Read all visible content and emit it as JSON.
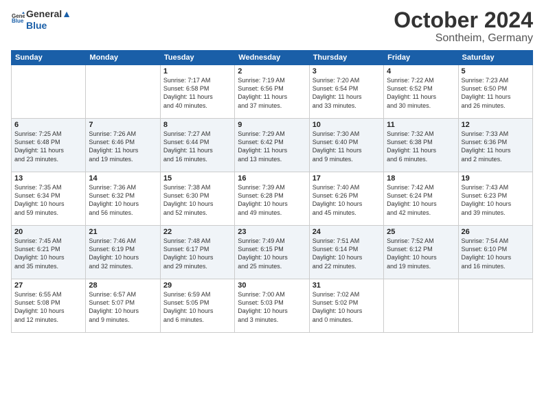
{
  "header": {
    "logo_line1": "General",
    "logo_line2": "Blue",
    "month": "October 2024",
    "location": "Sontheim, Germany"
  },
  "weekdays": [
    "Sunday",
    "Monday",
    "Tuesday",
    "Wednesday",
    "Thursday",
    "Friday",
    "Saturday"
  ],
  "weeks": [
    [
      {
        "day": "",
        "info": ""
      },
      {
        "day": "",
        "info": ""
      },
      {
        "day": "1",
        "info": "Sunrise: 7:17 AM\nSunset: 6:58 PM\nDaylight: 11 hours\nand 40 minutes."
      },
      {
        "day": "2",
        "info": "Sunrise: 7:19 AM\nSunset: 6:56 PM\nDaylight: 11 hours\nand 37 minutes."
      },
      {
        "day": "3",
        "info": "Sunrise: 7:20 AM\nSunset: 6:54 PM\nDaylight: 11 hours\nand 33 minutes."
      },
      {
        "day": "4",
        "info": "Sunrise: 7:22 AM\nSunset: 6:52 PM\nDaylight: 11 hours\nand 30 minutes."
      },
      {
        "day": "5",
        "info": "Sunrise: 7:23 AM\nSunset: 6:50 PM\nDaylight: 11 hours\nand 26 minutes."
      }
    ],
    [
      {
        "day": "6",
        "info": "Sunrise: 7:25 AM\nSunset: 6:48 PM\nDaylight: 11 hours\nand 23 minutes."
      },
      {
        "day": "7",
        "info": "Sunrise: 7:26 AM\nSunset: 6:46 PM\nDaylight: 11 hours\nand 19 minutes."
      },
      {
        "day": "8",
        "info": "Sunrise: 7:27 AM\nSunset: 6:44 PM\nDaylight: 11 hours\nand 16 minutes."
      },
      {
        "day": "9",
        "info": "Sunrise: 7:29 AM\nSunset: 6:42 PM\nDaylight: 11 hours\nand 13 minutes."
      },
      {
        "day": "10",
        "info": "Sunrise: 7:30 AM\nSunset: 6:40 PM\nDaylight: 11 hours\nand 9 minutes."
      },
      {
        "day": "11",
        "info": "Sunrise: 7:32 AM\nSunset: 6:38 PM\nDaylight: 11 hours\nand 6 minutes."
      },
      {
        "day": "12",
        "info": "Sunrise: 7:33 AM\nSunset: 6:36 PM\nDaylight: 11 hours\nand 2 minutes."
      }
    ],
    [
      {
        "day": "13",
        "info": "Sunrise: 7:35 AM\nSunset: 6:34 PM\nDaylight: 10 hours\nand 59 minutes."
      },
      {
        "day": "14",
        "info": "Sunrise: 7:36 AM\nSunset: 6:32 PM\nDaylight: 10 hours\nand 56 minutes."
      },
      {
        "day": "15",
        "info": "Sunrise: 7:38 AM\nSunset: 6:30 PM\nDaylight: 10 hours\nand 52 minutes."
      },
      {
        "day": "16",
        "info": "Sunrise: 7:39 AM\nSunset: 6:28 PM\nDaylight: 10 hours\nand 49 minutes."
      },
      {
        "day": "17",
        "info": "Sunrise: 7:40 AM\nSunset: 6:26 PM\nDaylight: 10 hours\nand 45 minutes."
      },
      {
        "day": "18",
        "info": "Sunrise: 7:42 AM\nSunset: 6:24 PM\nDaylight: 10 hours\nand 42 minutes."
      },
      {
        "day": "19",
        "info": "Sunrise: 7:43 AM\nSunset: 6:23 PM\nDaylight: 10 hours\nand 39 minutes."
      }
    ],
    [
      {
        "day": "20",
        "info": "Sunrise: 7:45 AM\nSunset: 6:21 PM\nDaylight: 10 hours\nand 35 minutes."
      },
      {
        "day": "21",
        "info": "Sunrise: 7:46 AM\nSunset: 6:19 PM\nDaylight: 10 hours\nand 32 minutes."
      },
      {
        "day": "22",
        "info": "Sunrise: 7:48 AM\nSunset: 6:17 PM\nDaylight: 10 hours\nand 29 minutes."
      },
      {
        "day": "23",
        "info": "Sunrise: 7:49 AM\nSunset: 6:15 PM\nDaylight: 10 hours\nand 25 minutes."
      },
      {
        "day": "24",
        "info": "Sunrise: 7:51 AM\nSunset: 6:14 PM\nDaylight: 10 hours\nand 22 minutes."
      },
      {
        "day": "25",
        "info": "Sunrise: 7:52 AM\nSunset: 6:12 PM\nDaylight: 10 hours\nand 19 minutes."
      },
      {
        "day": "26",
        "info": "Sunrise: 7:54 AM\nSunset: 6:10 PM\nDaylight: 10 hours\nand 16 minutes."
      }
    ],
    [
      {
        "day": "27",
        "info": "Sunrise: 6:55 AM\nSunset: 5:08 PM\nDaylight: 10 hours\nand 12 minutes."
      },
      {
        "day": "28",
        "info": "Sunrise: 6:57 AM\nSunset: 5:07 PM\nDaylight: 10 hours\nand 9 minutes."
      },
      {
        "day": "29",
        "info": "Sunrise: 6:59 AM\nSunset: 5:05 PM\nDaylight: 10 hours\nand 6 minutes."
      },
      {
        "day": "30",
        "info": "Sunrise: 7:00 AM\nSunset: 5:03 PM\nDaylight: 10 hours\nand 3 minutes."
      },
      {
        "day": "31",
        "info": "Sunrise: 7:02 AM\nSunset: 5:02 PM\nDaylight: 10 hours\nand 0 minutes."
      },
      {
        "day": "",
        "info": ""
      },
      {
        "day": "",
        "info": ""
      }
    ]
  ]
}
